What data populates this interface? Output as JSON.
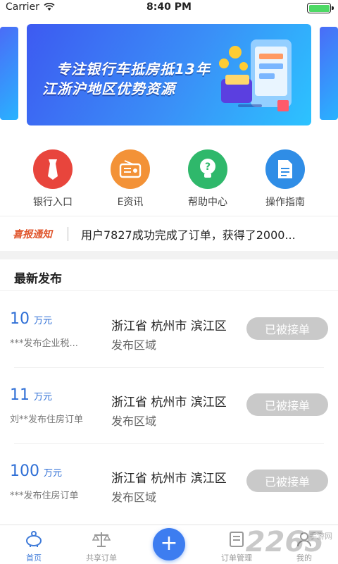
{
  "status_bar": {
    "carrier": "Carrier",
    "time": "8:40 PM"
  },
  "banner": {
    "line1": "专注银行车抵房抵13年",
    "line2": "江浙沪地区优势资源"
  },
  "menu": [
    {
      "label": "银行入口",
      "icon": "bank-tie-icon",
      "color": "#e8453c"
    },
    {
      "label": "E资讯",
      "icon": "radio-icon",
      "color": "#f39237"
    },
    {
      "label": "帮助中心",
      "icon": "question-bulb-icon",
      "color": "#2fb86b"
    },
    {
      "label": "操作指南",
      "icon": "document-icon",
      "color": "#2f8de6"
    }
  ],
  "notice": {
    "tag": "喜报通知",
    "text": "用户7827成功完成了订单，获得了2000..."
  },
  "section": {
    "title": "最新发布"
  },
  "orders": [
    {
      "amount": "10",
      "unit": "万元",
      "desc": "***发布企业税...",
      "address": "浙江省 杭州市 滨江区",
      "region": "发布区域",
      "status": "已被接单"
    },
    {
      "amount": "11",
      "unit": "万元",
      "desc": "刘**发布住房订单",
      "address": "浙江省 杭州市 滨江区",
      "region": "发布区域",
      "status": "已被接单"
    },
    {
      "amount": "100",
      "unit": "万元",
      "desc": "***发布住房订单",
      "address": "浙江省 杭州市 滨江区",
      "region": "发布区域",
      "status": "已被接单"
    }
  ],
  "tabbar": {
    "items": [
      {
        "label": "首页",
        "icon": "piggy-bank-icon"
      },
      {
        "label": "共享订单",
        "icon": "scales-icon"
      },
      {
        "label": "订单管理",
        "icon": "list-icon"
      },
      {
        "label": "我的",
        "icon": "user-icon"
      }
    ],
    "plus": "+",
    "accent": "#3f7bd9"
  },
  "watermark": {
    "logo": "2265",
    "small": "手游网"
  }
}
